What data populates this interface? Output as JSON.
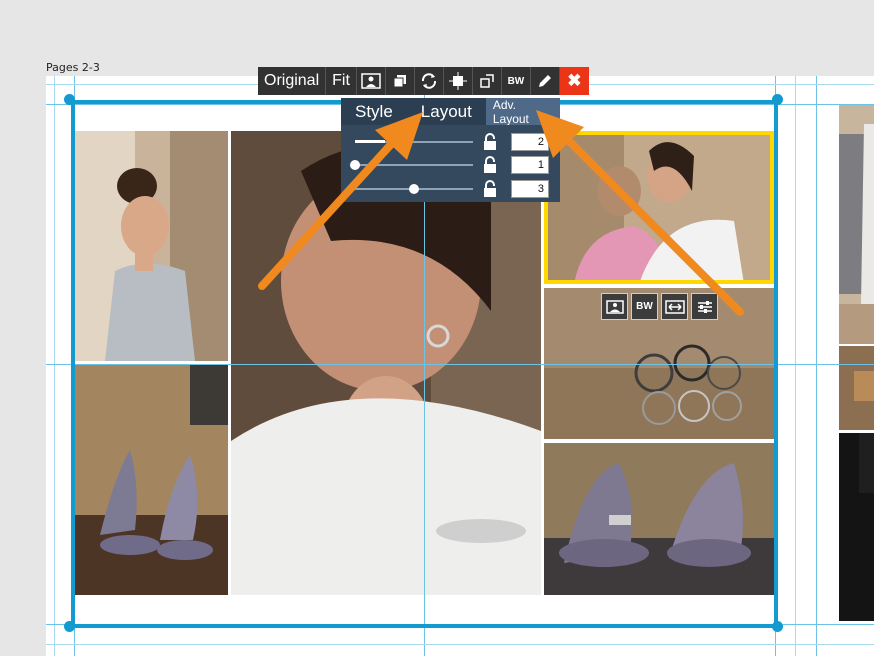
{
  "pages_label": "Pages 2-3",
  "toolbar": {
    "original_label": "Original",
    "fit_label": "Fit",
    "bw_label": "BW",
    "close_label": "✖",
    "accent": "#ec3417"
  },
  "layout_panel": {
    "tabs": [
      {
        "label": "Style"
      },
      {
        "label": "Layout"
      },
      {
        "label": "Adv. Layout"
      }
    ],
    "sliders": [
      {
        "value": "2",
        "fraction": 0.25
      },
      {
        "value": "1",
        "fraction": 0.0
      },
      {
        "value": "3",
        "fraction": 0.5
      }
    ]
  },
  "photo_toolbar": {
    "bw_label": "BW",
    "icons": [
      "edit-photo-icon",
      "bw-icon",
      "swap-icon",
      "adjust-icon"
    ]
  },
  "colors": {
    "selection_frame": "#139bd0",
    "selected_photo": "#ffd800",
    "annotation_arrow": "#f0891e"
  }
}
